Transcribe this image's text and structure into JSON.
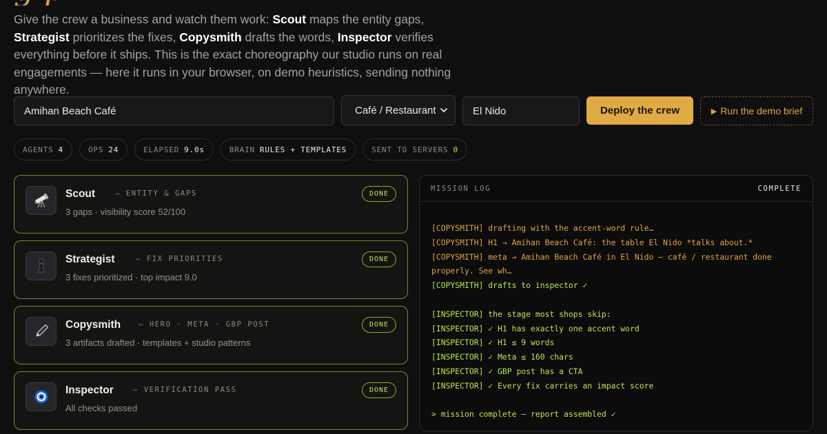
{
  "hero": {
    "title_fragment": "g        p",
    "intro": {
      "p1": "Give the crew a business and watch them work: ",
      "scout": "Scout",
      "p2": " maps the entity gaps, ",
      "strategist": "Strategist",
      "p3": " prioritizes the fixes, ",
      "copysmith": "Copysmith",
      "p4": " drafts the words, ",
      "inspector": "Inspector",
      "p5": " verifies everything before it ships. This is the exact choreography our studio runs on real engagements — here it runs in your browser, on demo heuristics, sending nothing anywhere."
    }
  },
  "form": {
    "business_name": "Amihan Beach Café",
    "business_type": "Café / Restaurant",
    "city": "El Nido",
    "deploy_label": "Deploy the crew",
    "demo_label": "Run the demo brief"
  },
  "stats": [
    {
      "key": "AGENTS",
      "value": "4"
    },
    {
      "key": "OPS",
      "value": "24"
    },
    {
      "key": "ELAPSED",
      "value": "9.0s"
    },
    {
      "key": "BRAIN",
      "value": "RULES + TEMPLATES"
    },
    {
      "key": "SENT TO SERVERS",
      "value": "0"
    }
  ],
  "agents": [
    {
      "name": "Scout",
      "role": "— ENTITY & GAPS",
      "desc": "3 gaps · visibility score 52/100",
      "status": "DONE",
      "icon": "telescope-icon"
    },
    {
      "name": "Strategist",
      "role": "— FIX PRIORITIES",
      "desc": "3 fixes prioritized · top impact 9.0",
      "status": "DONE",
      "icon": "chess-pawn-icon"
    },
    {
      "name": "Copysmith",
      "role": "— HERO · META · GBP POST",
      "desc": "3 artifacts drafted · templates + studio patterns",
      "status": "DONE",
      "icon": "pen-icon"
    },
    {
      "name": "Inspector",
      "role": "— VERIFICATION PASS",
      "desc": "All checks passed",
      "status": "DONE",
      "icon": "eye-icon"
    }
  ],
  "log": {
    "title": "MISSION LOG",
    "status": "COMPLETE",
    "lines": [
      {
        "t": "copy",
        "text": "[COPYSMITH] drafting with the accent-word rule…"
      },
      {
        "t": "copy",
        "text": "[COPYSMITH] H1 → Amihan Beach Café: the table El Nido *talks about.*"
      },
      {
        "t": "copy",
        "text": "[COPYSMITH] meta → Amihan Beach Café in El Nido — café / restaurant done"
      },
      {
        "t": "copy",
        "text": "properly. See wh…"
      },
      {
        "t": "insp",
        "text": "[COPYSMITH] drafts to inspector ✓"
      },
      {
        "t": "gap",
        "text": ""
      },
      {
        "t": "insp",
        "text": "[INSPECTOR] the stage most shops skip:"
      },
      {
        "t": "insp",
        "text": "[INSPECTOR] ✓ H1 has exactly one accent word"
      },
      {
        "t": "insp",
        "text": "[INSPECTOR] ✓ H1 ≤ 9 words"
      },
      {
        "t": "insp",
        "text": "[INSPECTOR] ✓ Meta ≤ 160 chars"
      },
      {
        "t": "insp",
        "text": "[INSPECTOR] ✓ GBP post has a CTA"
      },
      {
        "t": "insp",
        "text": "[INSPECTOR] ✓ Every fix carries an impact score"
      },
      {
        "t": "gap",
        "text": ""
      },
      {
        "t": "insp",
        "text": "> mission complete — report assembled ✓"
      }
    ]
  },
  "colors": {
    "accent": "#e0aa45",
    "success": "#b8e650",
    "card_border": "#7a8a2a"
  }
}
